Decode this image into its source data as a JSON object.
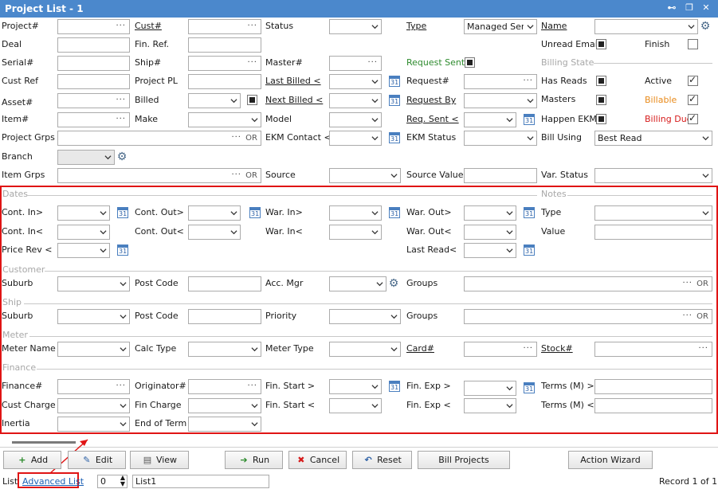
{
  "window": {
    "title": "Project List - 1",
    "pin": "⊷",
    "restore": "❐",
    "close": "✕"
  },
  "labels": {
    "project_no": "Project#",
    "deal": "Deal",
    "serial_no": "Serial#",
    "cust_ref": "Cust Ref",
    "asset_no": "Asset#",
    "item_no": "Item#",
    "project_grps": "Project Grps",
    "branch": "Branch",
    "item_grps": "Item Grps",
    "cust_no": "Cust#",
    "fin_ref": "Fin. Ref.",
    "ship_no": "Ship#",
    "project_pl": "Project PL",
    "billed": "Billed",
    "make": "Make",
    "status": "Status",
    "master_no": "Master#",
    "last_billed": "Last Billed <",
    "next_billed": "Next Billed <",
    "model": "Model",
    "ekm_contact": "EKM Contact <",
    "source": "Source",
    "type": "Type",
    "request_sent": "Request Sent",
    "request_no": "Request#",
    "request_by": "Request By",
    "req_sent": "Req. Sent <",
    "ekm_status": "EKM Status",
    "source_value": "Source Value",
    "name": "Name",
    "unread_email": "Unread Email",
    "finish": "Finish",
    "billing_state": "Billing State",
    "has_reads": "Has Reads",
    "active": "Active",
    "masters": "Masters",
    "billable": "Billable",
    "happen_ekm": "Happen EKM",
    "billing_due": "Billing Due",
    "bill_using": "Bill Using",
    "var_status": "Var. Status",
    "cont_in_gt": "Cont. In>",
    "cont_in_lt": "Cont. In<",
    "price_rev": "Price Rev <",
    "cont_out_gt": "Cont. Out>",
    "cont_out_lt": "Cont. Out<",
    "war_in_gt": "War. In>",
    "war_in_lt": "War. In<",
    "war_out_gt": "War. Out>",
    "war_out_lt": "War. Out<",
    "last_read": "Last Read<",
    "notes_type": "Type",
    "notes_value": "Value",
    "cust_suburb": "Suburb",
    "cust_post_code": "Post Code",
    "acc_mgr": "Acc. Mgr",
    "cust_groups": "Groups",
    "ship_suburb": "Suburb",
    "ship_post_code": "Post Code",
    "priority": "Priority",
    "ship_groups": "Groups",
    "meter_name": "Meter Name",
    "calc_type": "Calc Type",
    "meter_type": "Meter Type",
    "card_no": "Card#",
    "stock_no": "Stock#",
    "finance_no": "Finance#",
    "originator_no": "Originator#",
    "fin_start_gt": "Fin. Start >",
    "fin_exp_gt": "Fin. Exp >",
    "terms_gt": "Terms (M) >",
    "cust_charge": "Cust Charge",
    "fin_charge": "Fin Charge",
    "fin_start_lt": "Fin. Start <",
    "fin_exp_lt": "Fin. Exp <",
    "terms_lt": "Terms (M) <",
    "inertia": "Inertia",
    "end_of_term": "End of Term"
  },
  "sections": {
    "dates": "Dates",
    "notes": "Notes",
    "customer": "Customer",
    "ship": "Ship",
    "meter": "Meter",
    "finance": "Finance"
  },
  "fields": {
    "type_value": "Managed Servic",
    "bill_using_value": "Best Read",
    "or": "OR",
    "dots": "···",
    "cal_day": "31"
  },
  "buttons": {
    "add": "Add",
    "edit": "Edit",
    "view": "View",
    "run": "Run",
    "cancel": "Cancel",
    "reset": "Reset",
    "bill_projects": "Bill Projects",
    "action_wizard": "Action Wizard"
  },
  "statusbar": {
    "list_label": "List",
    "advanced_list": "Advanced List",
    "count": "0",
    "list_name": "List1",
    "record": "Record 1 of 1"
  },
  "colors": {
    "title_bg": "#4b88cc",
    "highlight": "#e01414",
    "green": "#2e8b2e",
    "orange": "#e88a1a",
    "red": "#d61a1a"
  }
}
